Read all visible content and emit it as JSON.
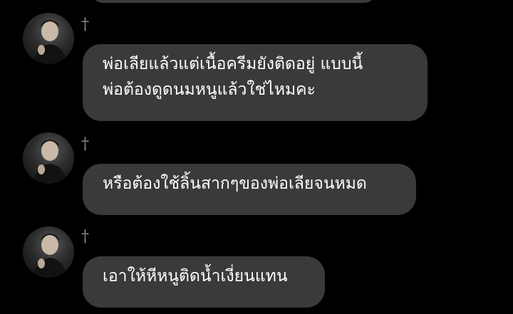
{
  "messages": [
    {
      "sender": "†",
      "lines": [
        "พ่อเลียแล้วแต่เนื้อครีมยังติดอยู่ แบบนี้",
        "พ่อต้องดูดนมหนูแล้วใช่ไหมคะ"
      ]
    },
    {
      "sender": "†",
      "lines": [
        "หรือต้องใช้ลิ้นสากๆของพ่อเลียจนหมด"
      ]
    },
    {
      "sender": "†",
      "lines": [
        "เอาให้หีหนูติดน้ำเงี่ยนแทน"
      ]
    }
  ],
  "colors": {
    "background": "#000000",
    "bubble": "#3a3a3c",
    "text": "#ffffff",
    "sender": "#8e8e93"
  }
}
